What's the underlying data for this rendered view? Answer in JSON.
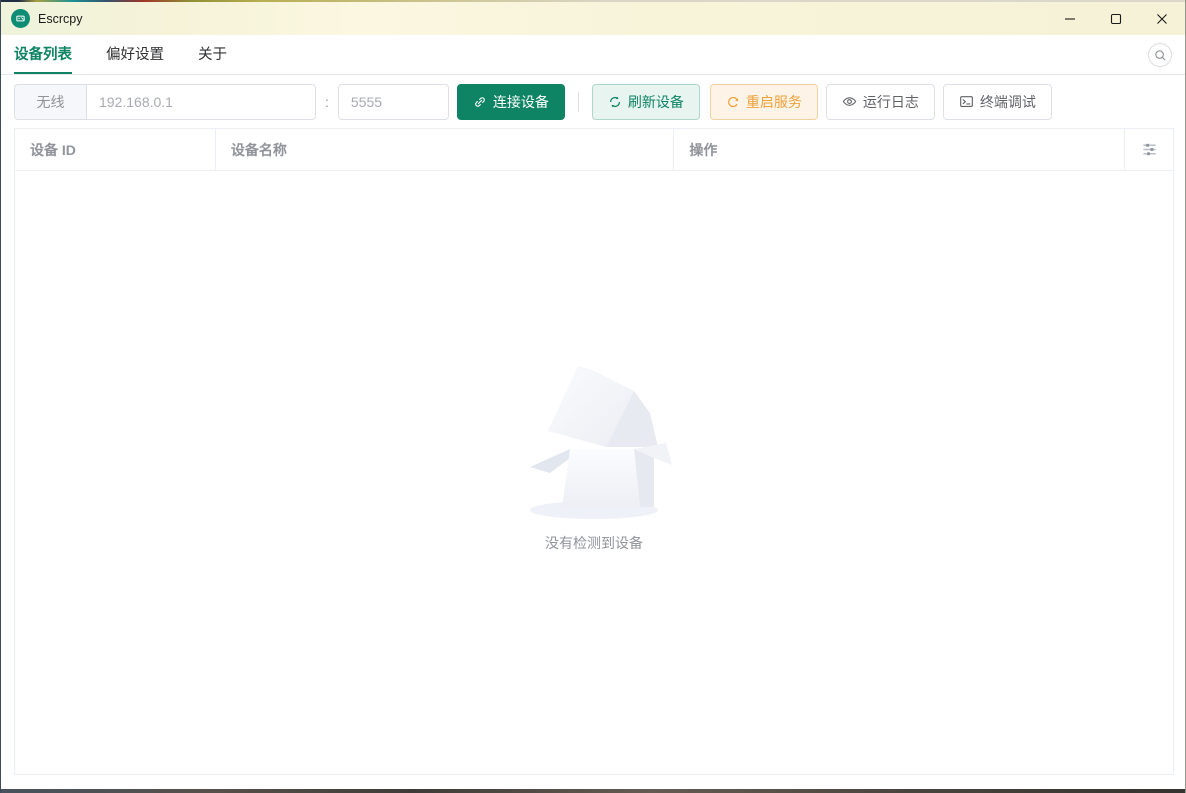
{
  "window": {
    "title": "Escrcpy"
  },
  "tabs": [
    {
      "label": "设备列表",
      "active": true
    },
    {
      "label": "偏好设置",
      "active": false
    },
    {
      "label": "关于",
      "active": false
    }
  ],
  "toolbar": {
    "wireless_label": "无线",
    "ip_value": "192.168.0.1",
    "separator": ":",
    "port_value": "5555",
    "connect_label": "连接设备",
    "refresh_label": "刷新设备",
    "restart_label": "重启服务",
    "logs_label": "运行日志",
    "terminal_label": "终端调试"
  },
  "table": {
    "columns": [
      {
        "label": "设备 ID"
      },
      {
        "label": "设备名称"
      },
      {
        "label": "操作"
      }
    ],
    "rows": [],
    "empty_text": "没有检测到设备"
  },
  "icons": {
    "app": "escrcpy-logo",
    "search": "search-icon",
    "connect": "link-icon",
    "refresh": "refresh-icon",
    "restart": "refresh-right-icon",
    "logs": "eye-icon",
    "terminal": "terminal-icon",
    "header_settings": "sliders-icon"
  },
  "colors": {
    "primary": "#0e8465",
    "success_plain_bg": "#e8f4ef",
    "warning": "#eda23c",
    "warning_plain_bg": "#fdf3e6",
    "header_text": "#909399",
    "border": "#dcdfe6",
    "table_border": "#ebeef5",
    "titlebar_bg": "#f8f4da"
  }
}
